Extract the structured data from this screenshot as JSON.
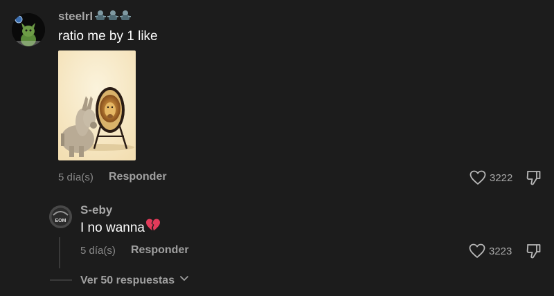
{
  "comment": {
    "username": "steelrl",
    "username_emojis": [
      "zombie-emoji",
      "zombie-emoji",
      "zombie-emoji"
    ],
    "text": "ratio me by 1 like",
    "age": "5 día(s)",
    "reply_label": "Responder",
    "like_count": "3222",
    "image_alt": "donkey-looking-in-mirror-sees-lion"
  },
  "reply": {
    "username": "S-eby",
    "avatar_text": "EOM",
    "text": "I no wanna",
    "text_emoji": "broken-heart-emoji",
    "age": "5 día(s)",
    "reply_label": "Responder",
    "like_count": "3223"
  },
  "thread": {
    "view_more_label": "Ver 50 respuestas"
  },
  "colors": {
    "background": "#1c1c1c",
    "username": "#a8a8a8",
    "meta": "#8a8a8a",
    "heart_emoji": "#e23b5a"
  }
}
